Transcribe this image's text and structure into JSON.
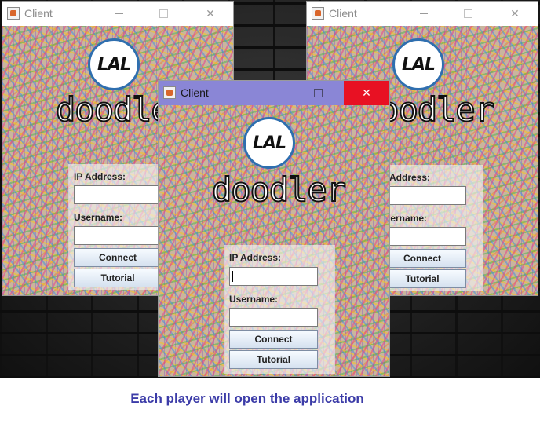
{
  "window_title": "Client",
  "titlebar": {
    "minimize": "—",
    "maximize": "☐",
    "close": "✕"
  },
  "logo": {
    "badge_text": "LAL",
    "word": "doodler"
  },
  "form": {
    "ip_label": "IP Address:",
    "username_label": "Username:",
    "ip_value": "",
    "username_value": "",
    "connect_label": "Connect",
    "tutorial_label": "Tutorial"
  },
  "caption": "Each player will open the application",
  "colors": {
    "active_titlebar": "#8a86d6",
    "close_hover": "#e81123",
    "caption": "#3c3ca8"
  }
}
